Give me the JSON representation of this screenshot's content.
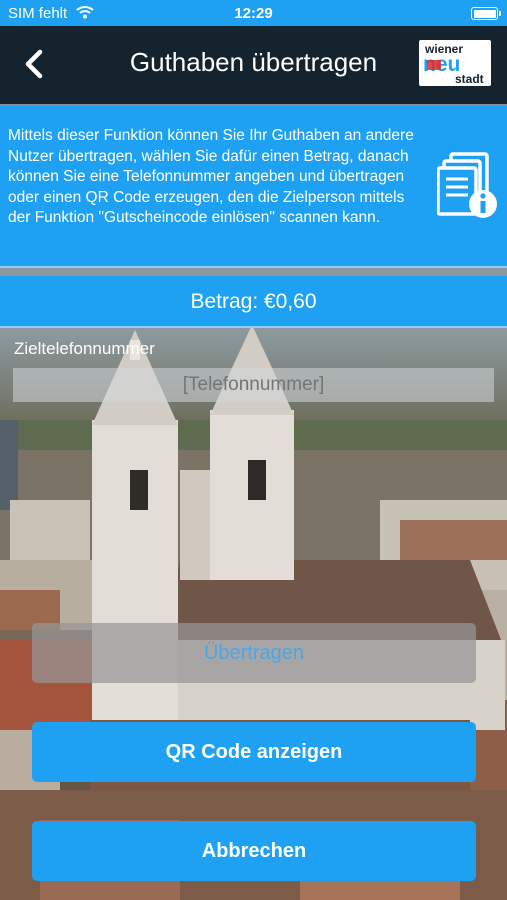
{
  "status_bar": {
    "carrier": "SIM fehlt",
    "time": "12:29"
  },
  "nav": {
    "title": "Guthaben übertragen",
    "logo_top": "wiener",
    "logo_mid": "neu",
    "logo_bottom": "stadt"
  },
  "info": {
    "text": "Mittels dieser Funktion können Sie Ihr Guthaben an andere Nutzer übertragen, wählen Sie dafür einen Betrag, danach können Sie eine Telefonnummer angeben und übertragen oder einen QR Code erzeugen, den die Zielperson mittels der Funktion \"Gutscheincode einlösen\" scannen kann."
  },
  "amount": {
    "label": "Betrag: €0,60"
  },
  "phone": {
    "label": "Zieltelefonnummer",
    "placeholder": "[Telefonnummer]"
  },
  "buttons": {
    "transfer": "Übertragen",
    "qr": "QR Code anzeigen",
    "cancel": "Abbrechen"
  },
  "colors": {
    "accent": "#1ea1f2",
    "navbar": "#15232e"
  }
}
